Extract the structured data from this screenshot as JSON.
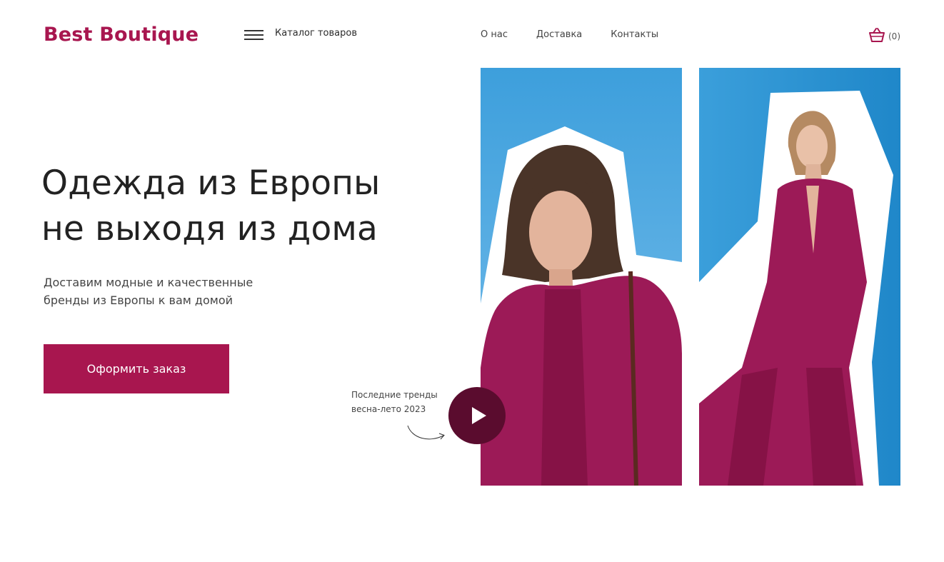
{
  "brand": {
    "name": "Best Boutique",
    "color": "#a8164f"
  },
  "header": {
    "catalog_label": "Каталог товаров",
    "nav": [
      "О нас",
      "Доставка",
      "Контакты"
    ],
    "cart_count": "(0)"
  },
  "hero": {
    "title_line1": "Одежда из Европы",
    "title_line2": "не выходя из дома",
    "subtitle_line1": "Доставим модные и качественные",
    "subtitle_line2": "бренды из Европы к вам домой",
    "cta_label": "Оформить заказ"
  },
  "trends": {
    "line1": "Последние тренды",
    "line2": "весна-лето 2023"
  },
  "icons": [
    "menu-icon",
    "basket-icon",
    "play-icon",
    "curved-arrow-icon"
  ],
  "colors": {
    "accent": "#a8164f",
    "play_button": "#5a0c2e",
    "photo_sky": "#3d9fdc",
    "outfit": "#9c1a57"
  }
}
